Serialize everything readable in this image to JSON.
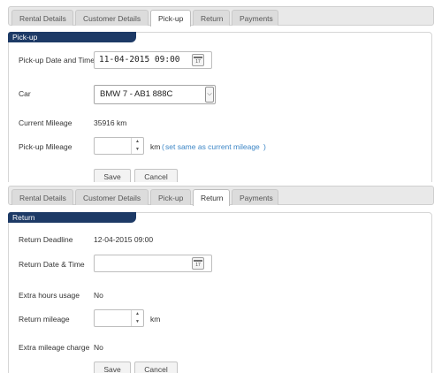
{
  "pickup_panel": {
    "tabs": [
      "Rental Details",
      "Customer Details",
      "Pick-up",
      "Return",
      "Payments"
    ],
    "section_title": "Pick-up",
    "pickup_datetime": {
      "label": "Pick-up Date and Time",
      "value": "11-04-2015 09:00"
    },
    "car": {
      "label": "Car",
      "selected": "BMW 7 - AB1 888C"
    },
    "current_mileage": {
      "label": "Current Mileage",
      "value": "35916 km"
    },
    "pickup_mileage": {
      "label": "Pick-up Mileage",
      "value": "",
      "unit": "km",
      "link_text": "set same as current mileage"
    },
    "buttons": {
      "save": "Save",
      "cancel": "Cancel"
    },
    "calendar_icon_text": "17"
  },
  "return_panel": {
    "tabs": [
      "Rental Details",
      "Customer Details",
      "Pick-up",
      "Return",
      "Payments"
    ],
    "section_title": "Return",
    "return_deadline": {
      "label": "Return Deadline",
      "value": "12-04-2015 09:00"
    },
    "return_datetime": {
      "label": "Return Date & Time",
      "value": ""
    },
    "extra_hours": {
      "label": "Extra hours usage",
      "value": "No"
    },
    "return_mileage": {
      "label": "Return mileage",
      "value": "",
      "unit": "km"
    },
    "extra_mileage_charge": {
      "label": "Extra mileage charge",
      "value": "No"
    },
    "buttons": {
      "save": "Save",
      "cancel": "Cancel"
    },
    "calendar_icon_text": "17"
  },
  "colors": {
    "legend_bg": "#1d3a66",
    "link": "#3c86c6",
    "tab_bar": "#e9e9e9"
  },
  "icons": [
    "calendar-icon",
    "chevron-down-icon",
    "spin-up-icon",
    "spin-down-icon"
  ]
}
